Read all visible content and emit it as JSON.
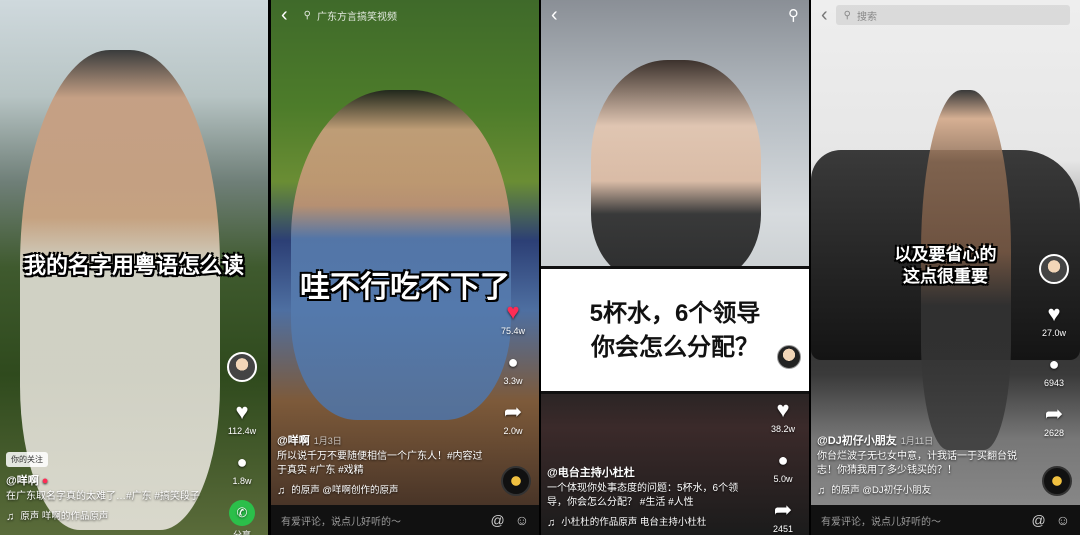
{
  "panels": [
    {
      "caption": "我的名字用粤语怎么读",
      "follow_tag": "你的关注",
      "author": "@咩啊",
      "description": "在广东取名字真的太难了…#广东 #搞笑段子",
      "music": "原声  咩啊的作品原声",
      "rail": {
        "likes": "112.4w",
        "comments": "1.8w",
        "share_label": "分享"
      }
    },
    {
      "search_placeholder": "广东方言搞笑视频",
      "caption": "哇不行吃不下了",
      "author": "@咩啊",
      "date": "1月3日",
      "description": "所以说千万不要随便相信一个广东人！#内容过于真实 #广东 #戏精",
      "music": "的原声  @咩啊创作的原声",
      "rail": {
        "likes": "75.4w",
        "comments": "3.3w",
        "shares": "2.0w"
      }
    },
    {
      "banner_line1": "5杯水，6个领导",
      "banner_line2": "你会怎么分配？",
      "author": "@电台主持小杜杜",
      "description": "一个体现你处事态度的问题：5杯水，6个领导，你会怎么分配？ #生活 #人性",
      "music": "小杜杜的作品原声    电台主持小杜杜",
      "rail": {
        "likes": "38.2w",
        "comments": "5.0w",
        "shares": "2451"
      }
    },
    {
      "search_placeholder": "搜索",
      "caption_line1": "以及要省心的",
      "caption_line2": "这点很重要",
      "author": "@DJ初仔小朋友",
      "date": "1月11日",
      "description": "你台烂波子无乜女中意，计我话一于买翻台锐志！你猜我用了多少钱买的？！",
      "music": "的原声  @DJ初仔小朋友",
      "rail": {
        "likes": "27.0w",
        "comments": "6943",
        "shares": "2628"
      }
    }
  ],
  "comment_placeholder": "有爱评论，说点儿好听的～",
  "colors": {
    "like_red": "#fe2c55",
    "share_green": "#2bbf4a",
    "comment_bar": "#111111"
  }
}
